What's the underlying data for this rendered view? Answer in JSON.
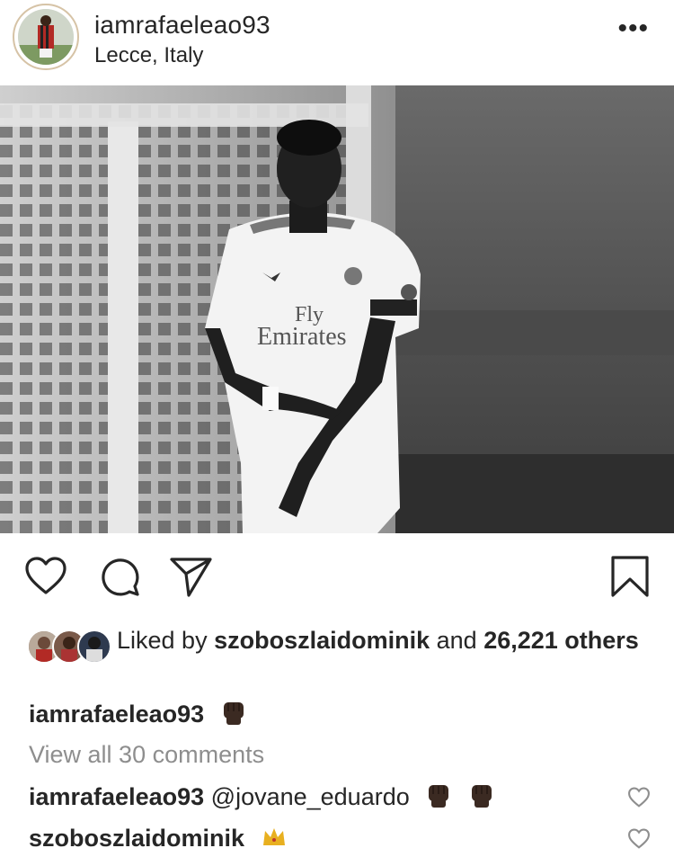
{
  "post": {
    "username": "iamrafaeleao93",
    "location": "Lecce, Italy",
    "more_label": "•••"
  },
  "photo": {
    "jersey_sponsor_line1": "Fly",
    "jersey_sponsor_line2": "Emirates"
  },
  "icons": {
    "like": "heart-icon",
    "comment": "comment-icon",
    "share": "direct-share-icon",
    "save": "bookmark-icon"
  },
  "likes": {
    "prefix": "Liked by ",
    "liker": "szoboszlaidominik",
    "middle": " and ",
    "count": "26,221",
    "suffix": " others"
  },
  "caption": {
    "username": "iamrafaeleao93",
    "emoji": "raised-fist-emoji"
  },
  "view_all_comments": "View all 30 comments",
  "comments": [
    {
      "username": "iamrafaeleao93",
      "mention": "@jovane_eduardo",
      "emoji": "raised-fist-emoji x2"
    },
    {
      "username": "szoboszlaidominik",
      "emoji": "crown-emoji"
    }
  ],
  "colors": {
    "text": "#262626",
    "muted": "#8e8e8e",
    "fist": "#3b2a22"
  }
}
